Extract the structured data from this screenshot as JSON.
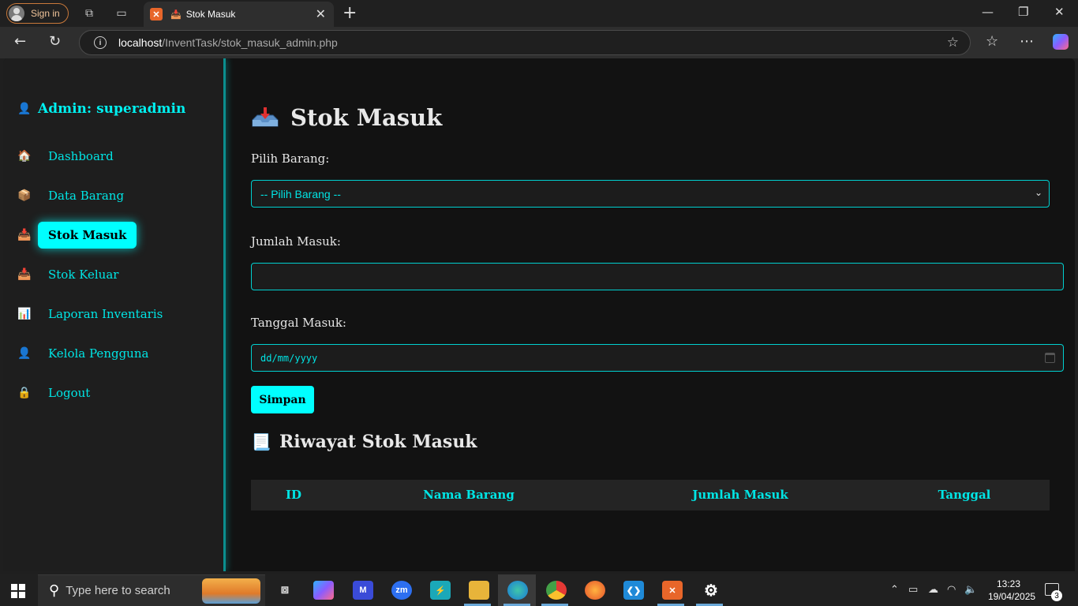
{
  "browser": {
    "signin_label": "Sign in",
    "tab_title": "Stok Masuk",
    "url_host": "localhost",
    "url_path": "/InventTask/stok_masuk_admin.php"
  },
  "sidebar": {
    "admin_label": "Admin: superadmin",
    "items": [
      {
        "label": "Dashboard",
        "icon": "house-icon"
      },
      {
        "label": "Data Barang",
        "icon": "box-icon"
      },
      {
        "label": "Stok Masuk",
        "icon": "inbox-tray-icon",
        "active": true
      },
      {
        "label": "Stok Keluar",
        "icon": "inbox-tray-icon"
      },
      {
        "label": "Laporan Inventaris",
        "icon": "bar-chart-icon"
      },
      {
        "label": "Kelola Pengguna",
        "icon": "user-icon"
      },
      {
        "label": "Logout",
        "icon": "lock-icon"
      }
    ]
  },
  "main": {
    "title": "Stok Masuk",
    "form": {
      "barang_label": "Pilih Barang:",
      "barang_selected": "-- Pilih Barang --",
      "jumlah_label": "Jumlah Masuk:",
      "jumlah_value": "",
      "tanggal_label": "Tanggal Masuk:",
      "tanggal_placeholder": "dd/mm/yyyy",
      "submit_label": "Simpan"
    },
    "history_title": "Riwayat Stok Masuk",
    "table_headers": [
      "ID",
      "Nama Barang",
      "Jumlah Masuk",
      "Tanggal"
    ]
  },
  "taskbar": {
    "search_placeholder": "Type here to search",
    "time": "13:23",
    "date": "19/04/2025",
    "notification_count": "3"
  },
  "colors": {
    "accent": "#00ffff",
    "page_bg": "#121212",
    "sidebar_bg": "#1e1e1e"
  }
}
